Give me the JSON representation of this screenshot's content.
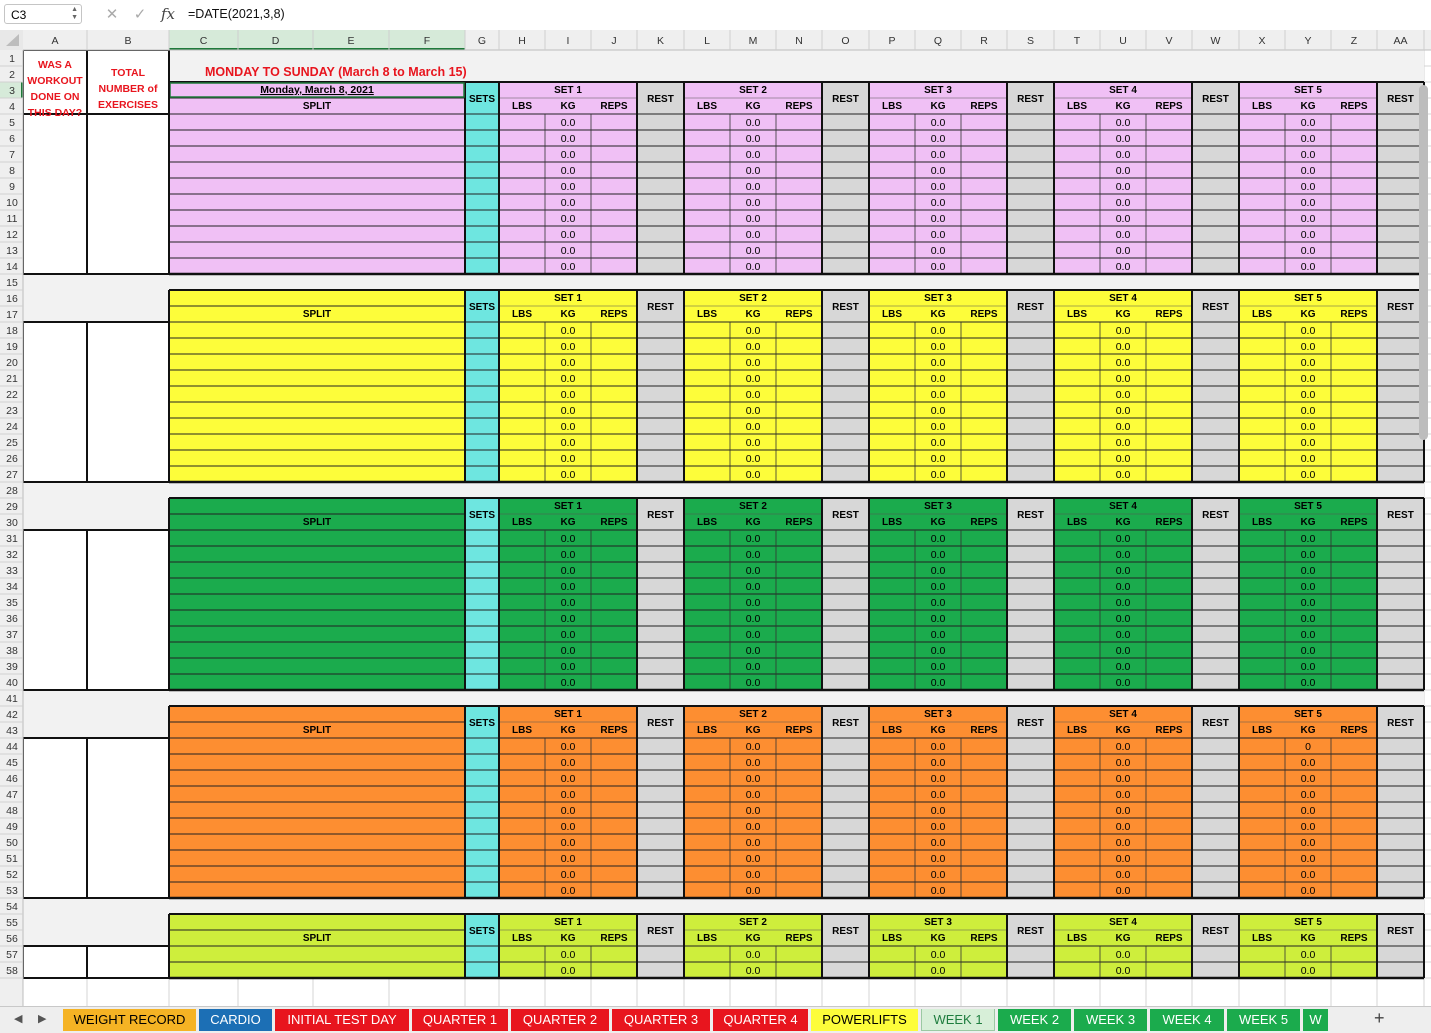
{
  "formula_bar": {
    "name_box": "C3",
    "cancel_icon": "✕",
    "confirm_icon": "✓",
    "fx_label": "fx",
    "formula": "=DATE(2021,3,8)"
  },
  "columns": [
    "A",
    "B",
    "C",
    "D",
    "E",
    "F",
    "G",
    "H",
    "I",
    "J",
    "K",
    "L",
    "M",
    "N",
    "O",
    "P",
    "Q",
    "R",
    "S",
    "T",
    "U",
    "V",
    "W",
    "X",
    "Y",
    "Z",
    "AA"
  ],
  "rows": [
    "1",
    "2",
    "3",
    "4",
    "5",
    "6",
    "7",
    "8",
    "9",
    "10",
    "11",
    "12",
    "13",
    "14",
    "15",
    "16",
    "17",
    "18",
    "19",
    "20",
    "21",
    "22",
    "23",
    "24",
    "25",
    "26",
    "27",
    "28",
    "29",
    "30",
    "31",
    "32",
    "33",
    "34",
    "35",
    "36",
    "37",
    "38",
    "39",
    "40",
    "41",
    "42",
    "43",
    "44",
    "45",
    "46",
    "47",
    "48",
    "49",
    "50",
    "51",
    "52",
    "53",
    "54",
    "55",
    "56",
    "57",
    "58"
  ],
  "sheet": {
    "col_a_header": "WAS A WORKOUT DONE ON THIS DAY?",
    "col_b_header": "TOTAL NUMBER of EXERCISES",
    "title": "MONDAY TO SUNDAY (March 8 to March 15)",
    "first_date": "Monday, March 8, 2021",
    "split_label": "SPLIT",
    "sets_label": "SETS",
    "rest_label": "REST",
    "set_labels": [
      "SET 1",
      "SET 2",
      "SET 3",
      "SET 4",
      "SET 5"
    ],
    "sub_labels": [
      "LBS",
      "KG",
      "REPS"
    ],
    "kg_value": "0.0",
    "kg_special": "0",
    "sections": [
      {
        "color": "#f0c0f5",
        "rows": 10
      },
      {
        "color": "#fdfd3a",
        "rows": 10
      },
      {
        "color": "#1bab4d",
        "rows": 10
      },
      {
        "color": "#fd8e31",
        "rows": 10
      },
      {
        "color": "#ceee3c",
        "rows": 2
      }
    ]
  },
  "tabs": [
    {
      "label": "WEIGHT RECORD",
      "bg": "#f5b324",
      "fg": "#000000"
    },
    {
      "label": "CARDIO",
      "bg": "#1c6fb5",
      "fg": "#ffffff"
    },
    {
      "label": "INITIAL TEST DAY",
      "bg": "#e8151e",
      "fg": "#ffffff"
    },
    {
      "label": "QUARTER 1",
      "bg": "#e8151e",
      "fg": "#ffffff"
    },
    {
      "label": "QUARTER 2",
      "bg": "#e8151e",
      "fg": "#ffffff"
    },
    {
      "label": "QUARTER 3",
      "bg": "#e8151e",
      "fg": "#ffffff"
    },
    {
      "label": "QUARTER 4",
      "bg": "#e8151e",
      "fg": "#ffffff"
    },
    {
      "label": "POWERLIFTS",
      "bg": "#fdfd3a",
      "fg": "#000000"
    },
    {
      "label": "WEEK 1",
      "bg": "#d7efd8",
      "fg": "#1e7d3e",
      "active": true
    },
    {
      "label": "WEEK 2",
      "bg": "#1bab4d",
      "fg": "#ffffff"
    },
    {
      "label": "WEEK 3",
      "bg": "#1bab4d",
      "fg": "#ffffff"
    },
    {
      "label": "WEEK 4",
      "bg": "#1bab4d",
      "fg": "#ffffff"
    },
    {
      "label": "WEEK 5",
      "bg": "#1bab4d",
      "fg": "#ffffff"
    },
    {
      "label": "W",
      "bg": "#1bab4d",
      "fg": "#ffffff"
    }
  ],
  "colors": {
    "header_bg": "#efefef",
    "selected_header": "#d6ead9",
    "sets_col": "#6ee6e0",
    "rest_col": "#d7d7d7",
    "title_red": "#e8151e",
    "grid": "#d4d4d4"
  }
}
